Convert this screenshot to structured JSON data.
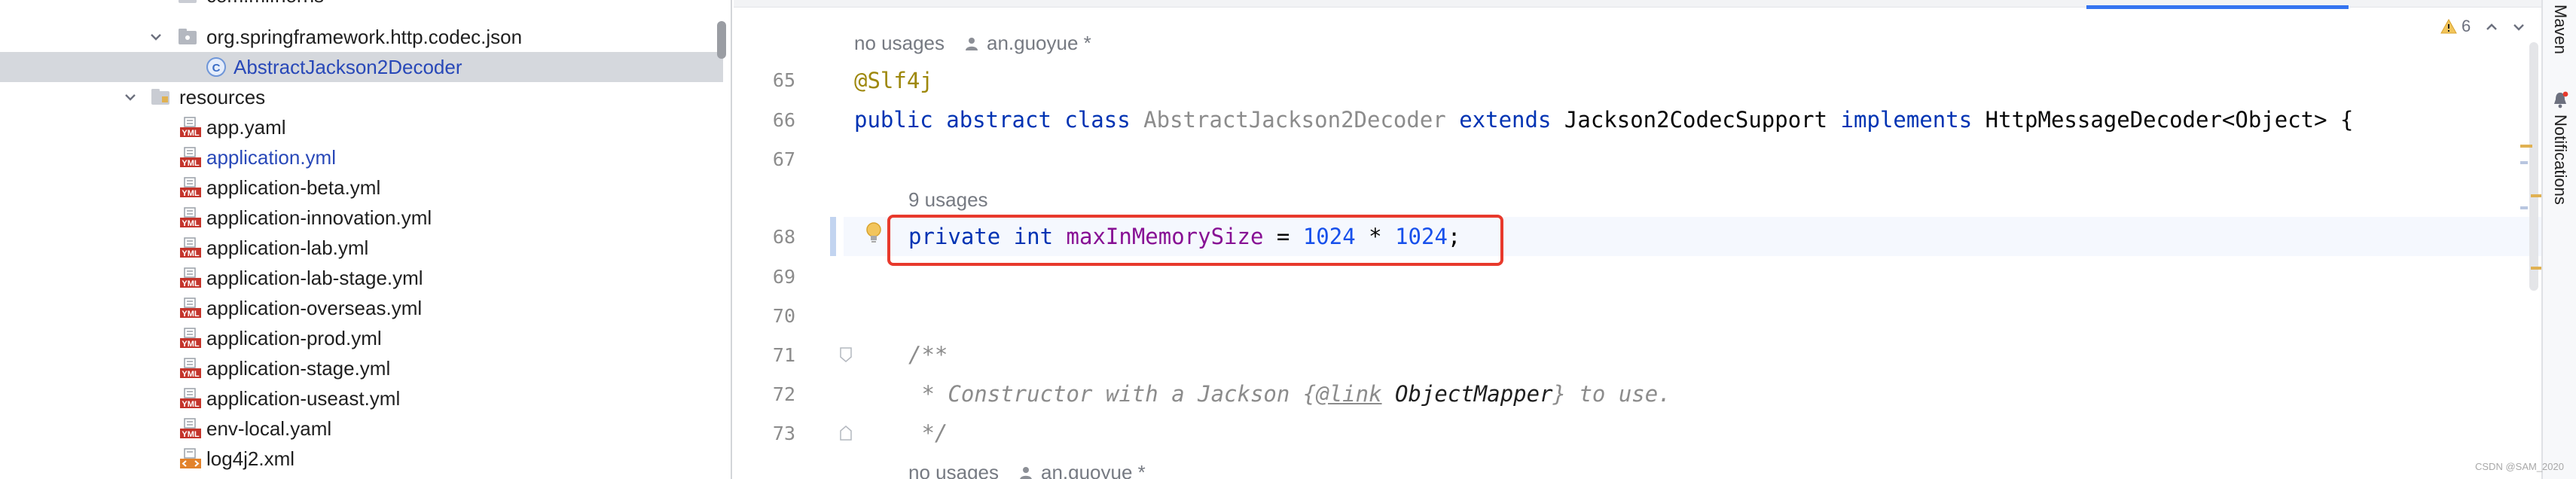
{
  "project_tree": {
    "rows": [
      {
        "label": "com.mifnorns",
        "kind": "package"
      },
      {
        "label": "org.springframework.http.codec.json",
        "kind": "package"
      },
      {
        "label": "AbstractJackson2Decoder",
        "kind": "class"
      },
      {
        "label": "resources",
        "kind": "folder"
      },
      {
        "label": "app.yaml",
        "kind": "yml"
      },
      {
        "label": "application.yml",
        "kind": "yml"
      },
      {
        "label": "application-beta.yml",
        "kind": "yml"
      },
      {
        "label": "application-innovation.yml",
        "kind": "yml"
      },
      {
        "label": "application-lab.yml",
        "kind": "yml"
      },
      {
        "label": "application-lab-stage.yml",
        "kind": "yml"
      },
      {
        "label": "application-overseas.yml",
        "kind": "yml"
      },
      {
        "label": "application-prod.yml",
        "kind": "yml"
      },
      {
        "label": "application-stage.yml",
        "kind": "yml"
      },
      {
        "label": "application-useast.yml",
        "kind": "yml"
      },
      {
        "label": "env-local.yaml",
        "kind": "yml"
      },
      {
        "label": "log4j2.xml",
        "kind": "xml"
      }
    ],
    "yml_badge": "YML",
    "class_badge": "C"
  },
  "editor": {
    "warnings_count": "6",
    "inlay_top": {
      "usages": "no usages",
      "author": "an.guoyue *"
    },
    "inlay_field": {
      "usages": "9 usages"
    },
    "inlay_bottom": {
      "usages": "no usages",
      "author": "an.guoyue *"
    },
    "line_numbers": [
      "65",
      "66",
      "67",
      "68",
      "69",
      "70",
      "71",
      "72",
      "73"
    ],
    "code": {
      "l65_annotation": "@Slf4j",
      "l66_kw1": "public",
      "l66_kw2": "abstract",
      "l66_kw3": "class",
      "l66_class": "AbstractJackson2Decoder",
      "l66_kw4": "extends",
      "l66_super": "Jackson2CodecSupport",
      "l66_kw5": "implements",
      "l66_iface": "HttpMessageDecoder<Object> {",
      "l68_kw1": "private",
      "l68_kw2": "int",
      "l68_field": "maxInMemorySize",
      "l68_eq": " = ",
      "l68_n1": "1024",
      "l68_op": " * ",
      "l68_n2": "1024",
      "l68_end": ";",
      "l71": "/**",
      "l72_a": " * Constructor with a Jackson {",
      "l72_tag": "@link",
      "l72_ref": " ObjectMapper",
      "l72_b": "} to use.",
      "l73": " */"
    }
  },
  "right_tool_strip": {
    "maven_label": "Maven",
    "notifications_label": "Notifications"
  },
  "watermark": "CSDN @SAM_2020",
  "colors": {
    "keyword": "#0033b3",
    "annotation": "#9e880d",
    "field": "#871094",
    "number": "#1750eb",
    "highlight_box": "#e8392c",
    "selected_row": "#d5d8dd",
    "vcs_modified": "#2848b8"
  }
}
